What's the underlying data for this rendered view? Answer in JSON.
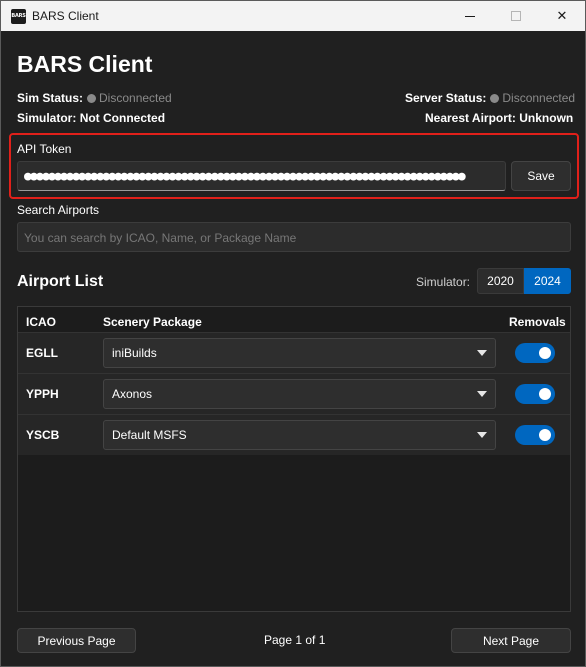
{
  "window": {
    "icon_text": "BARS",
    "title": "BARS Client"
  },
  "header": {
    "title": "BARS Client"
  },
  "status": {
    "sim_status_label": "Sim Status:",
    "sim_status_value": "Disconnected",
    "server_status_label": "Server Status:",
    "server_status_value": "Disconnected",
    "simulator_label": "Simulator:",
    "simulator_value": "Not Connected",
    "nearest_airport_label": "Nearest Airport:",
    "nearest_airport_value": "Unknown"
  },
  "api_token": {
    "label": "API Token",
    "value": "●●●●●●●●●●●●●●●●●●●●●●●●●●●●●●●●●●●●●●●●●●●●●●●●●●●●●●●●●●●●●●●●●●●●●●●●●",
    "save_label": "Save"
  },
  "search": {
    "label": "Search Airports",
    "placeholder": "You can search by ICAO, Name, or Package Name"
  },
  "airport_list": {
    "title": "Airport List",
    "simulator_label": "Simulator:",
    "simulator_options": [
      "2020",
      "2024"
    ],
    "selected_simulator": "2024",
    "columns": [
      "ICAO",
      "Scenery Package",
      "Removals"
    ],
    "rows": [
      {
        "icao": "EGLL",
        "package": "iniBuilds",
        "removals": true
      },
      {
        "icao": "YPPH",
        "package": "Axonos",
        "removals": true
      },
      {
        "icao": "YSCB",
        "package": "Default MSFS",
        "removals": true
      }
    ]
  },
  "pagination": {
    "previous_label": "Previous Page",
    "page_label": "Page 1 of 1",
    "next_label": "Next Page"
  },
  "colors": {
    "accent": "#0067c0",
    "highlight_border": "#e0201a",
    "background": "#202020"
  }
}
